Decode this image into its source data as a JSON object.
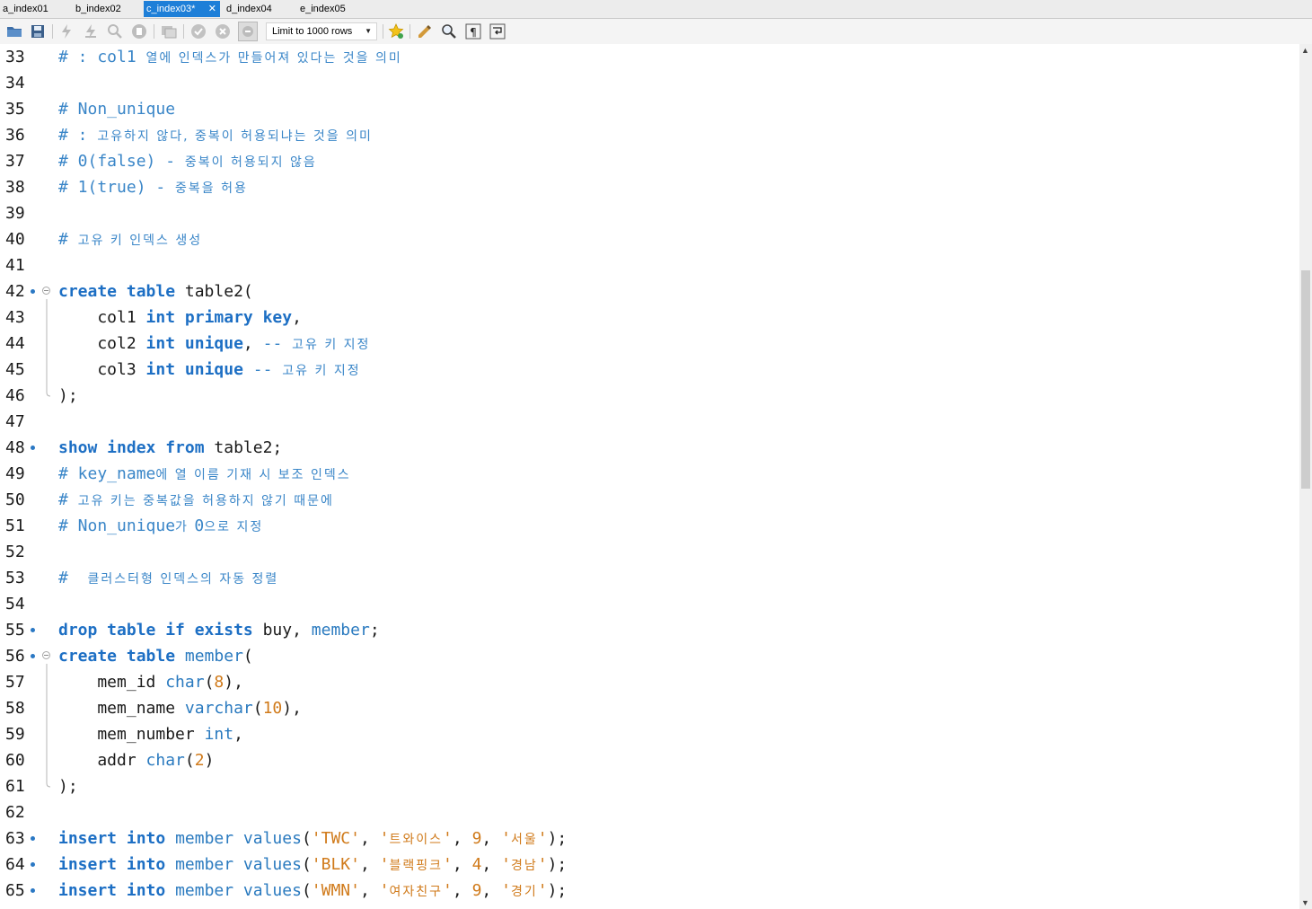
{
  "tabs": [
    {
      "label": "a_index01",
      "active": false
    },
    {
      "label": "b_index02",
      "active": false
    },
    {
      "label": "c_index03*",
      "active": true
    },
    {
      "label": "d_index04",
      "active": false
    },
    {
      "label": "e_index05",
      "active": false
    }
  ],
  "toolbar": {
    "limit_label": "Limit to 1000 rows",
    "icons": [
      "open-file-icon",
      "save-icon",
      "execute-icon",
      "execute-current-icon",
      "explain-icon",
      "stop-icon",
      "toggle-output-icon",
      "commit-icon",
      "rollback-icon",
      "auto-commit-icon",
      "bookmark-star-icon",
      "beautify-icon",
      "find-icon",
      "invisible-chars-icon",
      "word-wrap-icon"
    ]
  },
  "editor": {
    "accent_color": "#1d6fc4",
    "string_color": "#d07a1a",
    "lines": [
      {
        "num": "33",
        "marker": false,
        "fold": false
      },
      {
        "num": "34",
        "marker": false,
        "fold": false
      },
      {
        "num": "35",
        "marker": false,
        "fold": false
      },
      {
        "num": "36",
        "marker": false,
        "fold": false
      },
      {
        "num": "37",
        "marker": false,
        "fold": false
      },
      {
        "num": "38",
        "marker": false,
        "fold": false
      },
      {
        "num": "39",
        "marker": false,
        "fold": false
      },
      {
        "num": "40",
        "marker": false,
        "fold": false
      },
      {
        "num": "41",
        "marker": false,
        "fold": false
      },
      {
        "num": "42",
        "marker": true,
        "fold": true
      },
      {
        "num": "43",
        "marker": false,
        "fold": false
      },
      {
        "num": "44",
        "marker": false,
        "fold": false
      },
      {
        "num": "45",
        "marker": false,
        "fold": false
      },
      {
        "num": "46",
        "marker": false,
        "fold": false
      },
      {
        "num": "47",
        "marker": false,
        "fold": false
      },
      {
        "num": "48",
        "marker": true,
        "fold": false
      },
      {
        "num": "49",
        "marker": false,
        "fold": false
      },
      {
        "num": "50",
        "marker": false,
        "fold": false
      },
      {
        "num": "51",
        "marker": false,
        "fold": false
      },
      {
        "num": "52",
        "marker": false,
        "fold": false
      },
      {
        "num": "53",
        "marker": false,
        "fold": false
      },
      {
        "num": "54",
        "marker": false,
        "fold": false
      },
      {
        "num": "55",
        "marker": true,
        "fold": false
      },
      {
        "num": "56",
        "marker": true,
        "fold": true
      },
      {
        "num": "57",
        "marker": false,
        "fold": false
      },
      {
        "num": "58",
        "marker": false,
        "fold": false
      },
      {
        "num": "59",
        "marker": false,
        "fold": false
      },
      {
        "num": "60",
        "marker": false,
        "fold": false
      },
      {
        "num": "61",
        "marker": false,
        "fold": false
      },
      {
        "num": "62",
        "marker": false,
        "fold": false
      },
      {
        "num": "63",
        "marker": true,
        "fold": false
      },
      {
        "num": "64",
        "marker": true,
        "fold": false
      },
      {
        "num": "65",
        "marker": true,
        "fold": false
      }
    ],
    "code": [
      [
        {
          "c": "c",
          "t": "# : col1 "
        },
        {
          "c": "c ko",
          "t": "열에 인덱스가 만들어져 있다는 것을 의미"
        }
      ],
      [],
      [
        {
          "c": "c",
          "t": "# Non_unique"
        }
      ],
      [
        {
          "c": "c",
          "t": "# : "
        },
        {
          "c": "c ko",
          "t": "고유하지 않다, 중복이 허용되냐는 것을 의미"
        }
      ],
      [
        {
          "c": "c",
          "t": "# 0(false) - "
        },
        {
          "c": "c ko",
          "t": "중복이 허용되지 않음"
        }
      ],
      [
        {
          "c": "c",
          "t": "# 1(true) - "
        },
        {
          "c": "c ko",
          "t": "중복을 허용"
        }
      ],
      [],
      [
        {
          "c": "c",
          "t": "# "
        },
        {
          "c": "c ko",
          "t": "고유 키 인덱스 생성"
        }
      ],
      [],
      [
        {
          "c": "k",
          "t": "create table"
        },
        {
          "c": "",
          "t": " table2("
        }
      ],
      [
        {
          "c": "",
          "t": "    col1 "
        },
        {
          "c": "k",
          "t": "int primary key"
        },
        {
          "c": "",
          "t": ","
        }
      ],
      [
        {
          "c": "",
          "t": "    col2 "
        },
        {
          "c": "k",
          "t": "int unique"
        },
        {
          "c": "",
          "t": ", "
        },
        {
          "c": "c",
          "t": "-- "
        },
        {
          "c": "c ko",
          "t": "고유 키 지정"
        }
      ],
      [
        {
          "c": "",
          "t": "    col3 "
        },
        {
          "c": "k",
          "t": "int unique"
        },
        {
          "c": "",
          "t": " "
        },
        {
          "c": "c",
          "t": "-- "
        },
        {
          "c": "c ko",
          "t": "고유 키 지정"
        }
      ],
      [
        {
          "c": "",
          "t": ");"
        }
      ],
      [],
      [
        {
          "c": "k",
          "t": "show index from"
        },
        {
          "c": "",
          "t": " table2;"
        }
      ],
      [
        {
          "c": "c",
          "t": "# key_name"
        },
        {
          "c": "c ko",
          "t": "에 열 이름 기재 시 보조 인덱스"
        }
      ],
      [
        {
          "c": "c",
          "t": "# "
        },
        {
          "c": "c ko",
          "t": "고유 키는 중복값을 허용하지 않기 때문에"
        }
      ],
      [
        {
          "c": "c",
          "t": "# Non_unique"
        },
        {
          "c": "c ko",
          "t": "가 "
        },
        {
          "c": "c",
          "t": "0"
        },
        {
          "c": "c ko",
          "t": "으로 지정"
        }
      ],
      [],
      [
        {
          "c": "c",
          "t": "#  "
        },
        {
          "c": "c ko",
          "t": "클러스터형 인덱스의 자동 정렬"
        }
      ],
      [],
      [
        {
          "c": "k",
          "t": "drop table if exists"
        },
        {
          "c": "",
          "t": " buy, "
        },
        {
          "c": "t",
          "t": "member"
        },
        {
          "c": "",
          "t": ";"
        }
      ],
      [
        {
          "c": "k",
          "t": "create table"
        },
        {
          "c": "",
          "t": " "
        },
        {
          "c": "t",
          "t": "member"
        },
        {
          "c": "",
          "t": "("
        }
      ],
      [
        {
          "c": "",
          "t": "    mem_id "
        },
        {
          "c": "t",
          "t": "char"
        },
        {
          "c": "",
          "t": "("
        },
        {
          "c": "n",
          "t": "8"
        },
        {
          "c": "",
          "t": "),"
        }
      ],
      [
        {
          "c": "",
          "t": "    mem_name "
        },
        {
          "c": "t",
          "t": "varchar"
        },
        {
          "c": "",
          "t": "("
        },
        {
          "c": "n",
          "t": "10"
        },
        {
          "c": "",
          "t": "),"
        }
      ],
      [
        {
          "c": "",
          "t": "    mem_number "
        },
        {
          "c": "t",
          "t": "int"
        },
        {
          "c": "",
          "t": ","
        }
      ],
      [
        {
          "c": "",
          "t": "    addr "
        },
        {
          "c": "t",
          "t": "char"
        },
        {
          "c": "",
          "t": "("
        },
        {
          "c": "n",
          "t": "2"
        },
        {
          "c": "",
          "t": ")"
        }
      ],
      [
        {
          "c": "",
          "t": ");"
        }
      ],
      [],
      [
        {
          "c": "k",
          "t": "insert into"
        },
        {
          "c": "",
          "t": " "
        },
        {
          "c": "t",
          "t": "member values"
        },
        {
          "c": "",
          "t": "("
        },
        {
          "c": "s",
          "t": "'TWC'"
        },
        {
          "c": "",
          "t": ", "
        },
        {
          "c": "s",
          "t": "'"
        },
        {
          "c": "s ko",
          "t": "트와이스"
        },
        {
          "c": "s",
          "t": "'"
        },
        {
          "c": "",
          "t": ", "
        },
        {
          "c": "n",
          "t": "9"
        },
        {
          "c": "",
          "t": ", "
        },
        {
          "c": "s",
          "t": "'"
        },
        {
          "c": "s ko",
          "t": "서울"
        },
        {
          "c": "s",
          "t": "'"
        },
        {
          "c": "",
          "t": ");"
        }
      ],
      [
        {
          "c": "k",
          "t": "insert into"
        },
        {
          "c": "",
          "t": " "
        },
        {
          "c": "t",
          "t": "member values"
        },
        {
          "c": "",
          "t": "("
        },
        {
          "c": "s",
          "t": "'BLK'"
        },
        {
          "c": "",
          "t": ", "
        },
        {
          "c": "s",
          "t": "'"
        },
        {
          "c": "s ko",
          "t": "블랙핑크"
        },
        {
          "c": "s",
          "t": "'"
        },
        {
          "c": "",
          "t": ", "
        },
        {
          "c": "n",
          "t": "4"
        },
        {
          "c": "",
          "t": ", "
        },
        {
          "c": "s",
          "t": "'"
        },
        {
          "c": "s ko",
          "t": "경남"
        },
        {
          "c": "s",
          "t": "'"
        },
        {
          "c": "",
          "t": ");"
        }
      ],
      [
        {
          "c": "k",
          "t": "insert into"
        },
        {
          "c": "",
          "t": " "
        },
        {
          "c": "t",
          "t": "member values"
        },
        {
          "c": "",
          "t": "("
        },
        {
          "c": "s",
          "t": "'WMN'"
        },
        {
          "c": "",
          "t": ", "
        },
        {
          "c": "s",
          "t": "'"
        },
        {
          "c": "s ko",
          "t": "여자친구"
        },
        {
          "c": "s",
          "t": "'"
        },
        {
          "c": "",
          "t": ", "
        },
        {
          "c": "n",
          "t": "9"
        },
        {
          "c": "",
          "t": ", "
        },
        {
          "c": "s",
          "t": "'"
        },
        {
          "c": "s ko",
          "t": "경기"
        },
        {
          "c": "s",
          "t": "'"
        },
        {
          "c": "",
          "t": ");"
        }
      ]
    ]
  }
}
